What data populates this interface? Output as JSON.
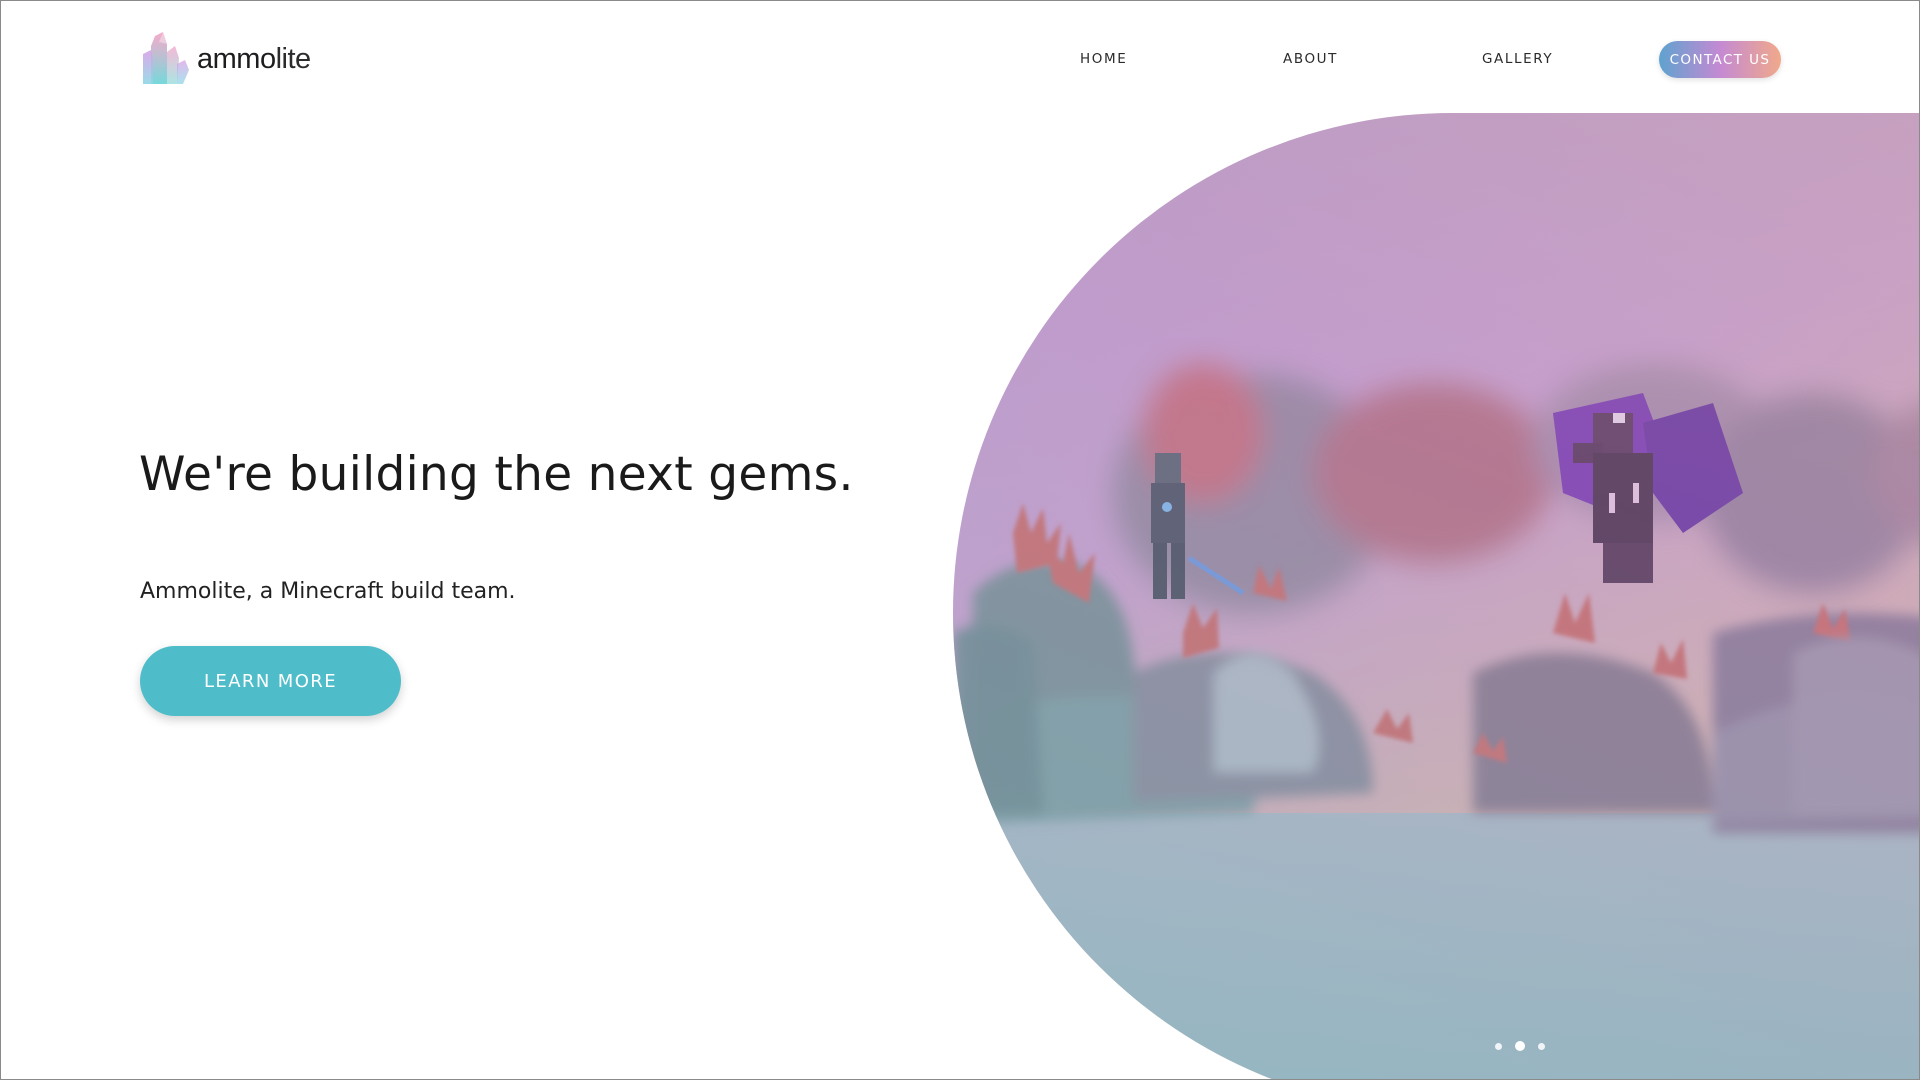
{
  "brand": {
    "name_bold": "ammo",
    "name_light": "lite",
    "logo_icon": "crystal-gem-icon"
  },
  "nav": {
    "home": "HOME",
    "about": "ABOUT",
    "gallery": "GALLERY",
    "contact": "CONTACT US"
  },
  "hero": {
    "title": "We're building the next gems.",
    "subtitle": "Ammolite, a Minecraft build team.",
    "cta": "LEARN MORE",
    "image_description_icon": "minecraft-dragon-scene-image",
    "slides_total": 3,
    "active_slide": 2
  },
  "colors": {
    "accent_teal": "#4ebdc9",
    "contact_gradient_start": "#5fa2cf",
    "contact_gradient_mid": "#c48ad3",
    "contact_gradient_end": "#f0a98a"
  }
}
